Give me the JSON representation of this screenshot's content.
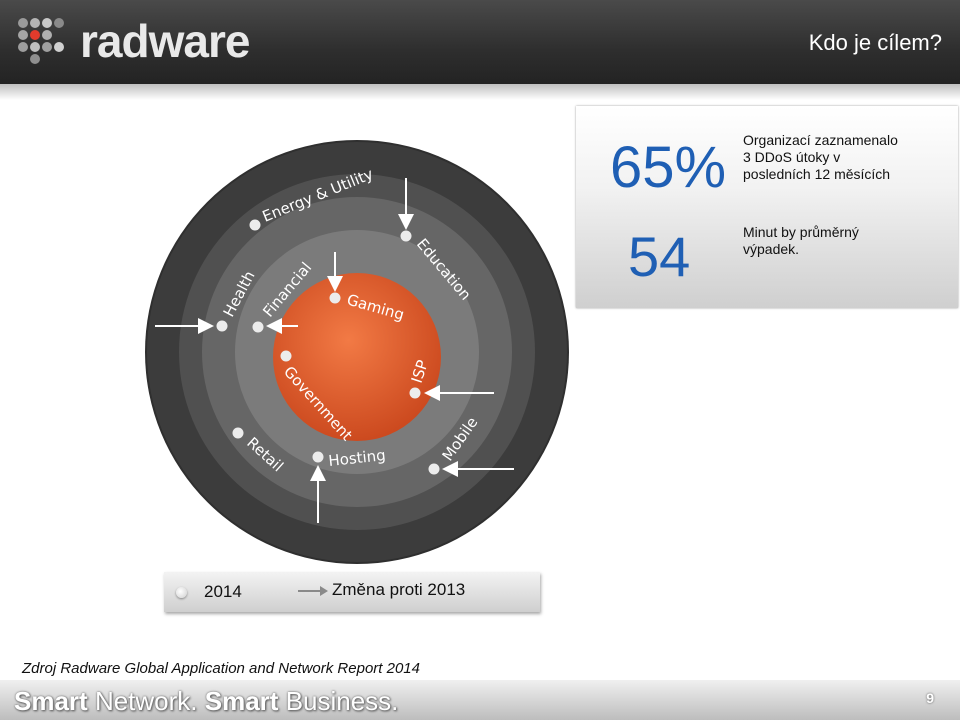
{
  "header": {
    "logo_text": "radware",
    "title": "Kdo je cílem?"
  },
  "stats": {
    "percent": "65%",
    "percent_text": [
      "Organizací zaznamenalo",
      "3 DDoS útoky v",
      "posledních 12 měsících"
    ],
    "minutes": "54",
    "minutes_text": [
      "Minut by průměrný",
      "výpadek."
    ]
  },
  "diagram": {
    "labels": {
      "energy": "Energy & Utility",
      "education": "Education",
      "health": "Health",
      "financial": "Financial",
      "gaming": "Gaming",
      "government": "Government",
      "isp": "ISP",
      "retail": "Retail",
      "hosting": "Hosting",
      "mobile": "Mobile"
    },
    "colors": {
      "ring1": "#3a3a3a",
      "ring2": "#545454",
      "ring3": "#6b6b6b",
      "ring4": "#8a8a8a",
      "core": "#e55a2b"
    }
  },
  "legend": {
    "year": "2014",
    "change": "Změna proti 2013"
  },
  "source": "Zdroj Radware Global Application and Network Report 2014",
  "footer": {
    "tagline_smart1": "Smart",
    "tagline_network": "Network.",
    "tagline_smart2": "Smart",
    "tagline_business": "Business.",
    "page": "9"
  }
}
